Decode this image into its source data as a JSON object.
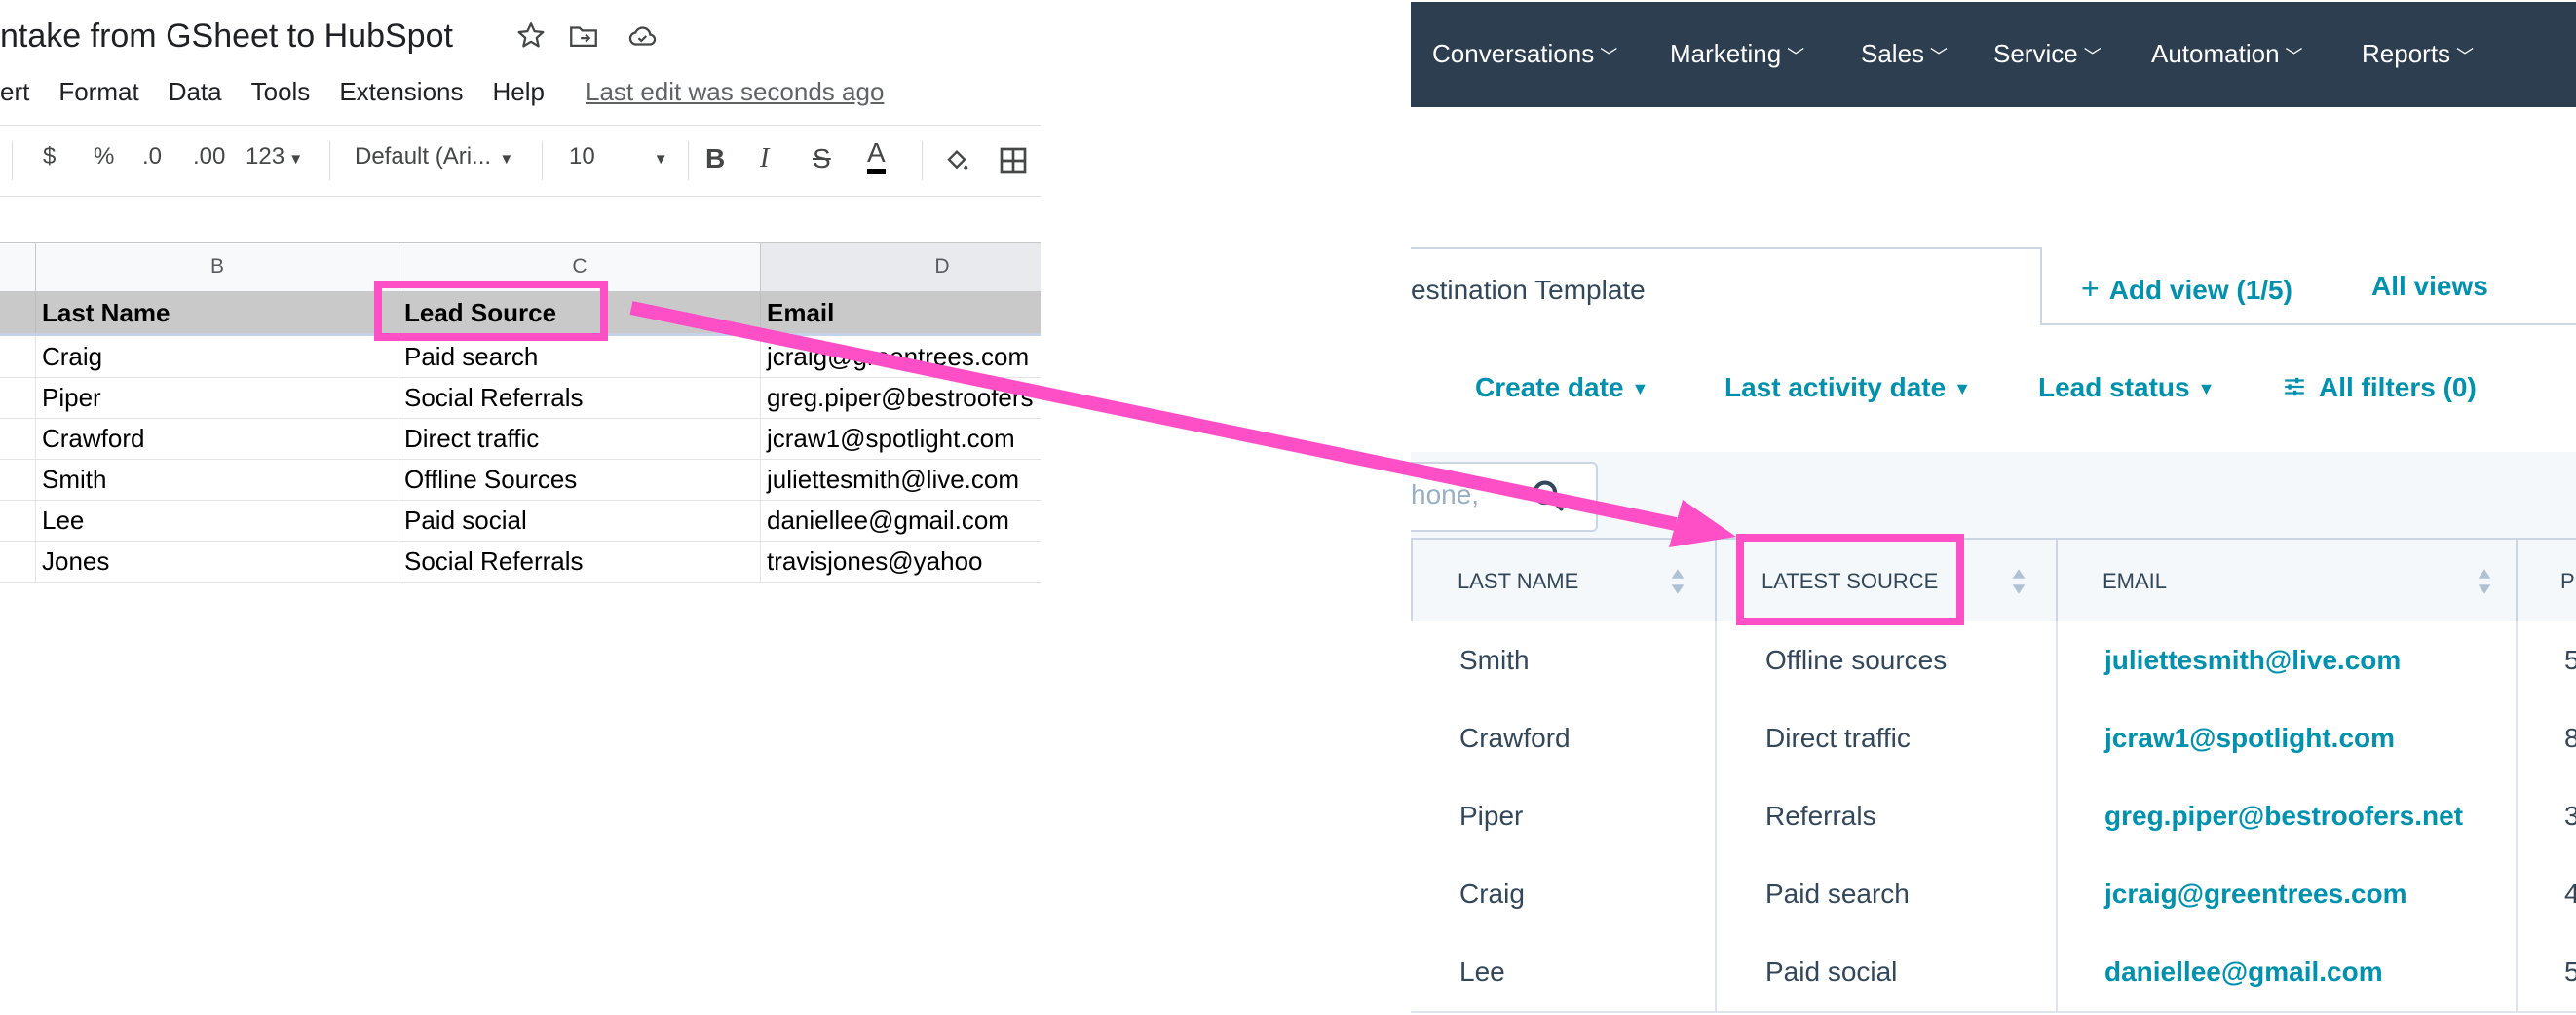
{
  "gsheet": {
    "doc_title": "ntake from GSheet to HubSpot",
    "menu": [
      "ert",
      "Format",
      "Data",
      "Tools",
      "Extensions",
      "Help"
    ],
    "last_edit": "Last edit was seconds ago",
    "toolbar": {
      "currency": "$",
      "percent": "%",
      "dec_decrease": ".0",
      "dec_increase": ".00",
      "number_format": "123",
      "font": "Default (Ari...",
      "font_size": "10"
    },
    "column_letters": [
      "B",
      "C",
      "D"
    ],
    "header_row": [
      "Last Name",
      "Lead Source",
      "Email"
    ],
    "rows": [
      [
        "Craig",
        "Paid search",
        "jcraig@greentrees.com"
      ],
      [
        "Piper",
        "Social Referrals",
        "greg.piper@bestroofers"
      ],
      [
        "Crawford",
        "Direct traffic",
        "jcraw1@spotlight.com"
      ],
      [
        "Smith",
        "Offline Sources",
        "juliettesmith@live.com"
      ],
      [
        "Lee",
        "Paid social",
        "daniellee@gmail.com"
      ],
      [
        "Jones",
        "Social Referrals",
        "travisjones@yahoo"
      ]
    ]
  },
  "hubspot": {
    "nav": [
      "Conversations",
      "Marketing",
      "Sales",
      "Service",
      "Automation",
      "Reports"
    ],
    "view_tab": "estination Template",
    "add_view": "Add view (1/5)",
    "all_views": "All views",
    "filters": [
      "Create date",
      "Last activity date",
      "Lead status"
    ],
    "all_filters": "All filters (0)",
    "search_placeholder": "hone,",
    "columns": [
      "LAST NAME",
      "LATEST SOURCE",
      "EMAIL",
      "P"
    ],
    "rows": [
      {
        "last_name": "Smith",
        "source": "Offline sources",
        "email": "juliettesmith@live.com",
        "p": "5"
      },
      {
        "last_name": "Crawford",
        "source": "Direct traffic",
        "email": "jcraw1@spotlight.com",
        "p": "8"
      },
      {
        "last_name": "Piper",
        "source": "Referrals",
        "email": "greg.piper@bestroofers.net",
        "p": "3"
      },
      {
        "last_name": "Craig",
        "source": "Paid search",
        "email": "jcraig@greentrees.com",
        "p": "4"
      },
      {
        "last_name": "Lee",
        "source": "Paid social",
        "email": "daniellee@gmail.com",
        "p": "5"
      }
    ]
  },
  "colors": {
    "annotation_pink": "#ff4fc6",
    "hubspot_nav": "#2d3e50",
    "hubspot_link": "#0091ae"
  }
}
